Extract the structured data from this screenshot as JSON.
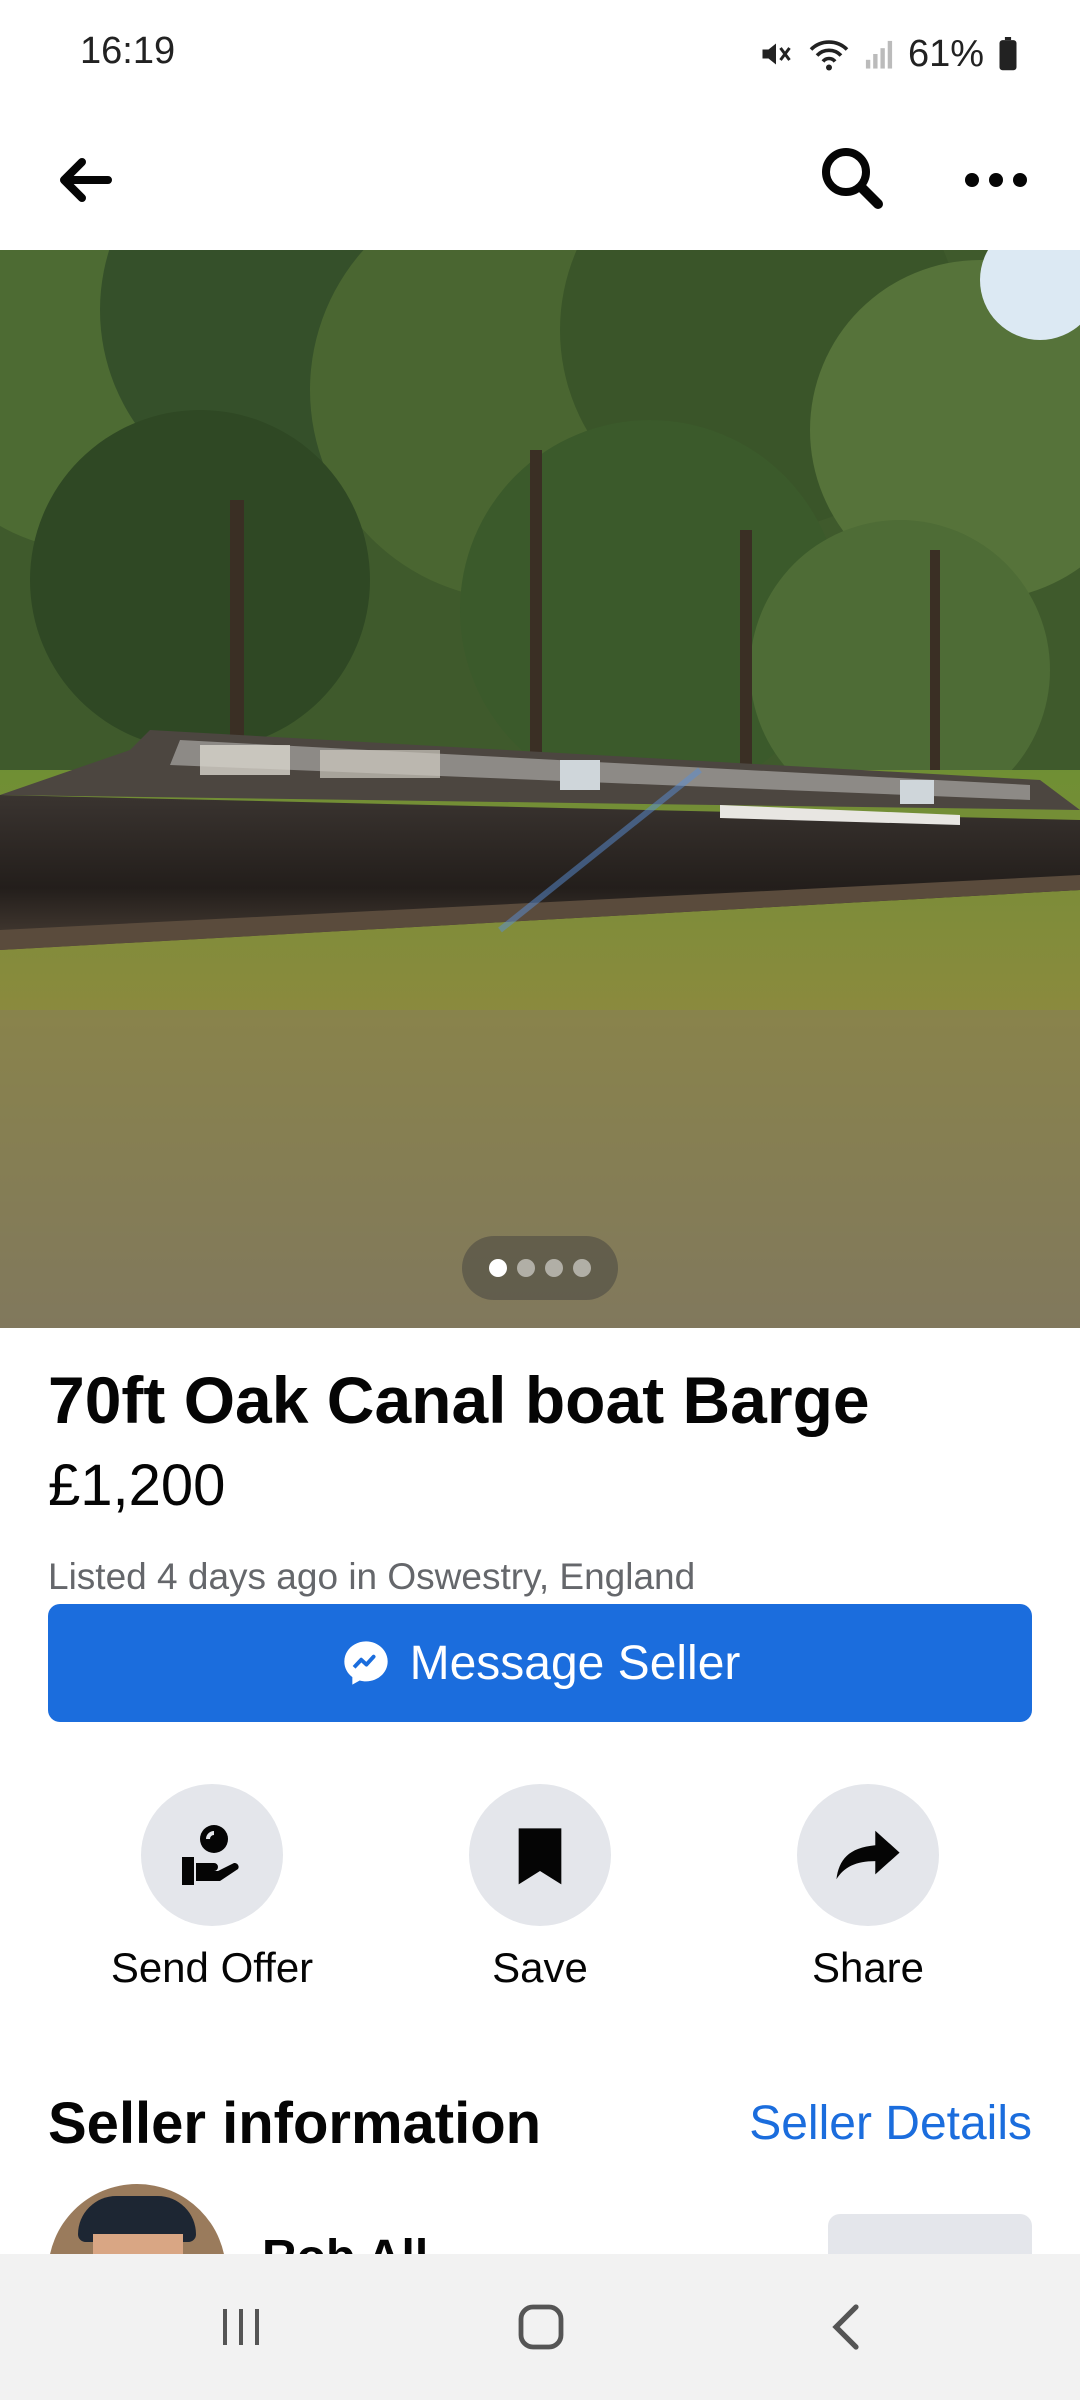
{
  "status": {
    "time": "16:19",
    "battery": "61%"
  },
  "topbar": {
    "back_icon": "arrow-left-icon",
    "search_icon": "search-icon",
    "more_icon": "more-horizontal-icon"
  },
  "listing": {
    "title": "70ft Oak Canal boat Barge",
    "price": "£1,200",
    "listed": "Listed 4 days ago in Oswestry, England",
    "photo_count": 4,
    "photo_index": 1
  },
  "message_button": {
    "label": "Message Seller",
    "icon": "messenger-icon"
  },
  "actions": [
    {
      "label": "Send Offer",
      "icon": "send-offer-icon"
    },
    {
      "label": "Save",
      "icon": "bookmark-icon"
    },
    {
      "label": "Share",
      "icon": "share-icon"
    }
  ],
  "seller": {
    "section_title": "Seller information",
    "details_link": "Seller Details",
    "name_partial": "Rob All"
  },
  "colors": {
    "accent": "#1b6ddd",
    "button_bg": "#e4e6eb",
    "muted_text": "#65676b"
  }
}
